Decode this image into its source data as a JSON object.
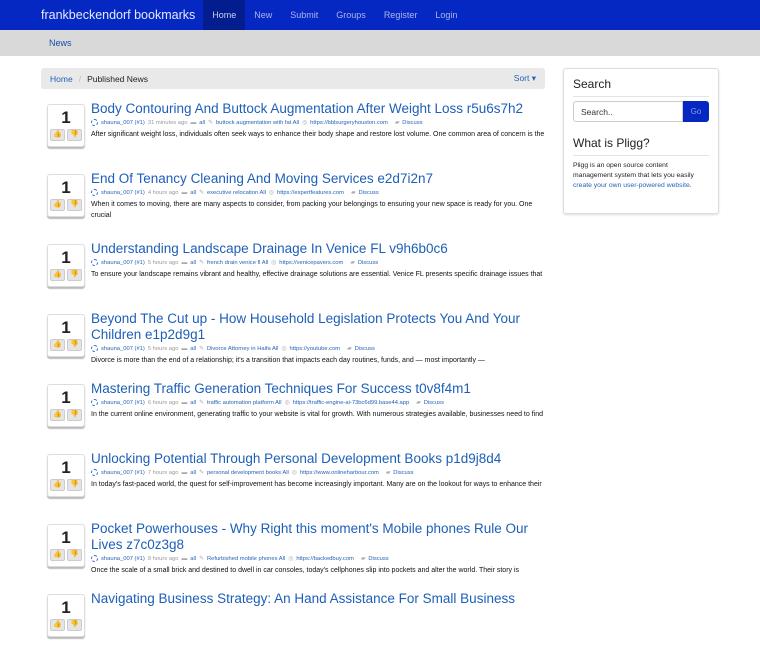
{
  "nav": {
    "brand": "frankbeckendorf bookmarks",
    "items": [
      "Home",
      "New",
      "Submit",
      "Groups",
      "Register",
      "Login"
    ]
  },
  "subnav": {
    "item": "News"
  },
  "breadcrumb": {
    "home": "Home",
    "current": "Published News",
    "sort": "Sort ▾"
  },
  "stories": [
    {
      "votes": "1",
      "title": "Body Contouring And Buttock Augmentation After Weight Loss r5u6s7h2",
      "user": "shauna_007 (#1)",
      "time": "31 minutes ago",
      "category": "all",
      "tags": "buttock augmentation with fat All",
      "url": "https://bblsurgeryhouston.com",
      "discuss": "Discuss",
      "desc": "After significant weight loss, individuals often seek ways to enhance their body shape and restore lost volume. One common area of concern is the"
    },
    {
      "votes": "1",
      "title": "End Of Tenancy Cleaning And Moving Services e2d7i2n7",
      "user": "shauna_007 (#1)",
      "time": "4 hours ago",
      "category": "all",
      "tags": "executive relocation All",
      "url": "https://expertfeatures.com",
      "discuss": "Discuss",
      "desc": "When it comes to moving, there are many aspects to consider, from packing your belongings to ensuring your new space is ready for you. One crucial"
    },
    {
      "votes": "1",
      "title": "Understanding Landscape Drainage In Venice FL v9h6b0c6",
      "user": "shauna_007 (#1)",
      "time": "5 hours ago",
      "category": "all",
      "tags": "french drain venice fl All",
      "url": "https://venicepavers.com",
      "discuss": "Discuss",
      "desc": "To ensure your landscape remains vibrant and healthy, effective drainage solutions are essential. Venice FL presents specific drainage issues that"
    },
    {
      "votes": "1",
      "title": "Beyond The Cut up - How Household Legislation Protects You And Your Children e1p2d9g1",
      "user": "shauna_007 (#1)",
      "time": "5 hours ago",
      "category": "all",
      "tags": "Divorce Attorney in Haifa All",
      "url": "https://youtube.com",
      "discuss": "Discuss",
      "desc": "Divorce is more than the end of a relationship; it's a transition that impacts each day routines, funds, and — most importantly —"
    },
    {
      "votes": "1",
      "title": "Mastering Traffic Generation Techniques For Success t0v8f4m1",
      "user": "shauna_007 (#1)",
      "time": "6 hours ago",
      "category": "all",
      "tags": "traffic automation platform All",
      "url": "https://traffic-engine-ai-73bc6d99.base44.app",
      "discuss": "Discuss",
      "desc": "In the current online environment, generating traffic to your website is vital for growth. With numerous strategies available, businesses need to find"
    },
    {
      "votes": "1",
      "title": "Unlocking Potential Through Personal Development Books p1d9j8d4",
      "user": "shauna_007 (#1)",
      "time": "7 hours ago",
      "category": "all",
      "tags": "personal development books All",
      "url": "https://www.onlineharbour.com",
      "discuss": "Discuss",
      "desc": "In today's fast-paced world, the quest for self-improvement has become increasingly important. Many are on the lookout for ways to enhance their"
    },
    {
      "votes": "1",
      "title": "Pocket Powerhouses - Why Right this moment's Mobile phones Rule Our Lives z7c0z3g8",
      "user": "shauna_007 (#1)",
      "time": "8 hours ago",
      "category": "all",
      "tags": "Refurbished mobile phones All",
      "url": "https://backedbuy.com",
      "discuss": "Discuss",
      "desc": "Once the scale of a small brick and destined to dwell in car consoles, today's cellphones slip into pockets and alter the world. Their story is"
    },
    {
      "votes": "1",
      "title": "Navigating Business Strategy: An Hand Assistance For Small Business",
      "user": "",
      "time": "",
      "category": "",
      "tags": "",
      "url": "",
      "discuss": "",
      "desc": ""
    }
  ],
  "sidebar": {
    "search_title": "Search",
    "search_placeholder": "Search..",
    "go": "Go",
    "pligg_title": "What is Pligg?",
    "pligg_text": "Pligg is an open source content management system that lets you easily ",
    "pligg_link": "create your own user-powered website",
    "pligg_end": "."
  }
}
